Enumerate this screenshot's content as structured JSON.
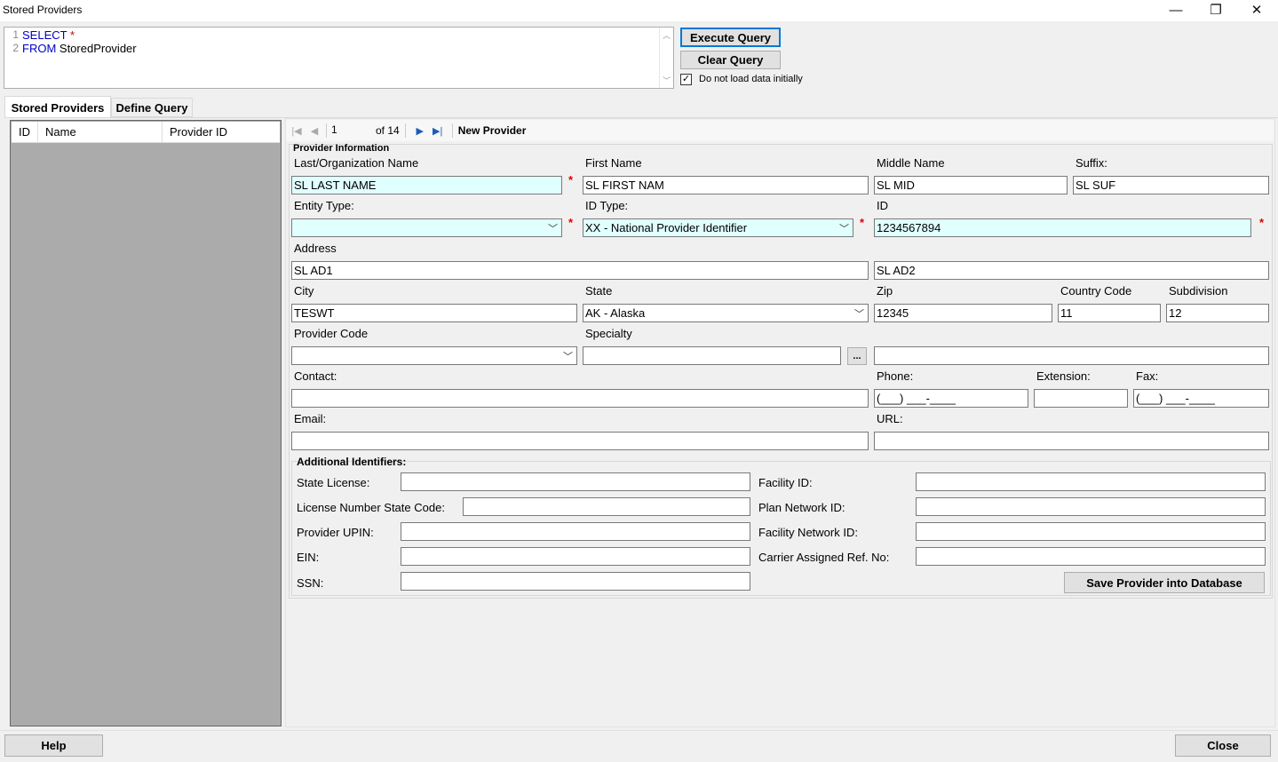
{
  "window": {
    "title": "Stored Providers",
    "controls": {
      "minimize": "—",
      "restore": "❐",
      "close": "✕"
    }
  },
  "query": {
    "lines": [
      {
        "num": "1",
        "kw": "SELECT",
        "rest": " *"
      },
      {
        "num": "2",
        "kw": "FROM",
        "rest": " StoredProvider"
      }
    ],
    "execute_label": "Execute Query",
    "clear_label": "Clear Query",
    "no_load_label": "Do not load data initially",
    "no_load_checked": "✓"
  },
  "tabs": {
    "stored": "Stored Providers",
    "define": "Define Query"
  },
  "grid": {
    "columns": [
      "ID",
      "Name",
      "Provider ID"
    ]
  },
  "navigator": {
    "position": "1",
    "of_label": "of 14",
    "new_label": "New Provider"
  },
  "form": {
    "group_title": "Provider Information",
    "labels": {
      "last_name": "Last/Organization Name",
      "first_name": "First Name",
      "middle_name": "Middle Name",
      "suffix": "Suffix:",
      "entity_type": "Entity Type:",
      "id_type": "ID Type:",
      "id": "ID",
      "address": "Address",
      "city": "City",
      "state": "State",
      "zip": "Zip",
      "country": "Country Code",
      "subdivision": "Subdivision",
      "provider_code": "Provider Code",
      "specialty": "Specialty",
      "contact": "Contact:",
      "phone": "Phone:",
      "extension": "Extension:",
      "fax": "Fax:",
      "email": "Email:",
      "url": "URL:"
    },
    "values": {
      "last_name": "SL LAST NAME",
      "first_name": "SL FIRST NAM",
      "middle_name": "SL MID",
      "suffix": "SL SUF",
      "entity_type": "",
      "id_type": "XX - National Provider Identifier",
      "id": "1234567894",
      "address1": "SL AD1",
      "address2": "SL  AD2",
      "city": "TESWT",
      "state": "AK - Alaska",
      "zip": "12345",
      "country": "11",
      "subdivision": "12",
      "provider_code": "",
      "specialty": "",
      "specialty_desc": "",
      "contact": "",
      "phone": "(___) ___-____",
      "extension": "",
      "fax": "(___) ___-____",
      "email": "",
      "url": ""
    },
    "required_mark": "*",
    "specialty_button": "...",
    "additional": {
      "title": "Additional Identifiers:",
      "state_license": "State License:",
      "license_state_code": "License Number State Code:",
      "upin": "Provider UPIN:",
      "ein": "EIN:",
      "ssn": "SSN:",
      "facility_id": "Facility ID:",
      "plan_network_id": "Plan Network ID:",
      "facility_network_id": "Facility Network ID:",
      "carrier_ref": "Carrier Assigned Ref. No:",
      "save_label": "Save Provider into Database"
    }
  },
  "footer": {
    "help": "Help",
    "close": "Close"
  }
}
